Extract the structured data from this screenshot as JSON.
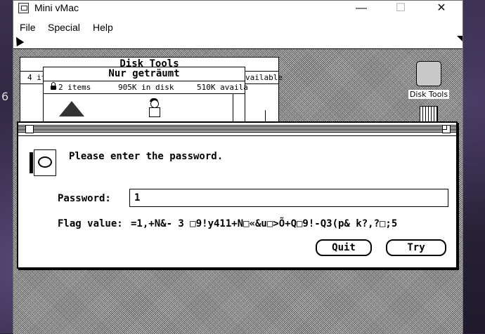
{
  "host": {
    "window_title": "Mini vMac",
    "menu": [
      "File",
      "Special",
      "Help"
    ],
    "side_text": "6"
  },
  "finder": {
    "disk_tools_window": {
      "title": "Disk Tools",
      "info_left": "4 it",
      "info_right": "vailable"
    },
    "nur_window": {
      "title": "Nur geträumt",
      "items": "2 items",
      "in_disk": "905K in disk",
      "available": "510K availa"
    },
    "desktop_icons": [
      {
        "label": "Disk Tools",
        "icon": "disk-icon"
      },
      {
        "label": "",
        "icon": "trash-icon"
      }
    ]
  },
  "dialog": {
    "message": "Please enter the password.",
    "password_label": "Password:",
    "password_value": "1",
    "flag_label": "Flag value:",
    "flag_value": "=1,+N&-  3 □9!y411+N□«&u□>Õ+Q□9!-Q3(p& k?,?□;5",
    "quit_label": "Quit",
    "try_label": "Try"
  }
}
